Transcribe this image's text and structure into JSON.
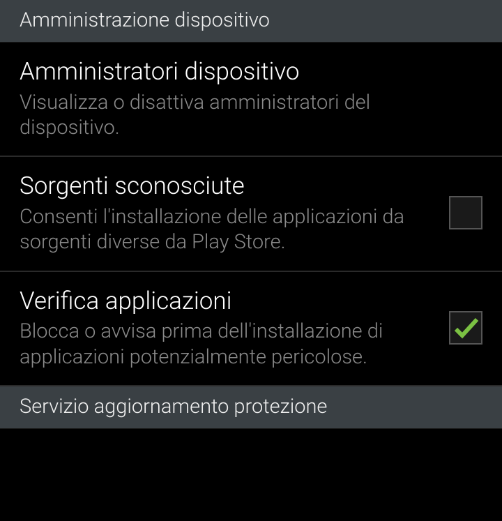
{
  "sections": [
    {
      "header": "Amministrazione dispositivo",
      "items": [
        {
          "title": "Amministratori dispositivo",
          "subtitle": "Visualizza o disattiva amministratori del dispositivo.",
          "checkbox": null
        },
        {
          "title": "Sorgenti sconosciute",
          "subtitle": "Consenti l'installazione delle applicazioni da sorgenti diverse da Play Store.",
          "checkbox": false
        },
        {
          "title": "Verifica applicazioni",
          "subtitle": "Blocca o avvisa prima dell'installazione di applicazioni potenzialmente pericolose.",
          "checkbox": true
        }
      ]
    },
    {
      "header": "Servizio aggiornamento protezione",
      "items": []
    }
  ]
}
